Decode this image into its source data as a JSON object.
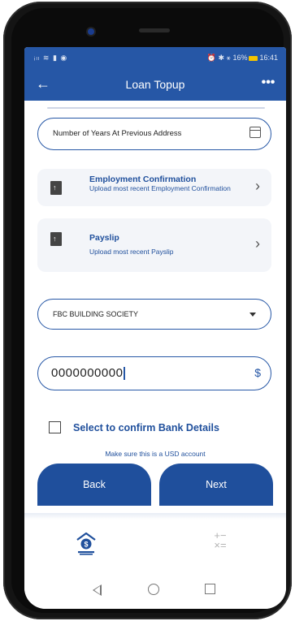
{
  "status_bar": {
    "left_icons": "ᵢₗₗ ≋ ▮ ◉",
    "right_text": "⏰ ✱ ⚹ 16%",
    "time": "16:41"
  },
  "app_bar": {
    "back_icon": "arrow-left-icon",
    "title": "Loan Topup",
    "more_label": "•••"
  },
  "form": {
    "years_field_placeholder": "Number of Years At Previous Address",
    "employment_card": {
      "title": "Employment Confirmation",
      "subtitle": "Upload most recent Employment Confirmation"
    },
    "payslip_card": {
      "title": "Payslip",
      "subtitle": "Upload most recent Payslip"
    },
    "bank_select_value": "FBC BUILDING SOCIETY",
    "account_number_value": "0000000000",
    "currency_symbol": "$",
    "confirm_checkbox_label": "Select to confirm Bank Details",
    "confirm_checked": false,
    "note": "Make sure this is a  USD account"
  },
  "buttons": {
    "back_label": "Back",
    "next_label": "Next"
  },
  "tab_bar": {
    "home_icon": "bank-money-icon",
    "calculator_icon": "calculator-icon",
    "calculator_glyph": "+ −\n× ="
  },
  "colors": {
    "primary": "#2657a6",
    "button": "#1f4f9c",
    "card_bg": "#f3f5f9"
  }
}
